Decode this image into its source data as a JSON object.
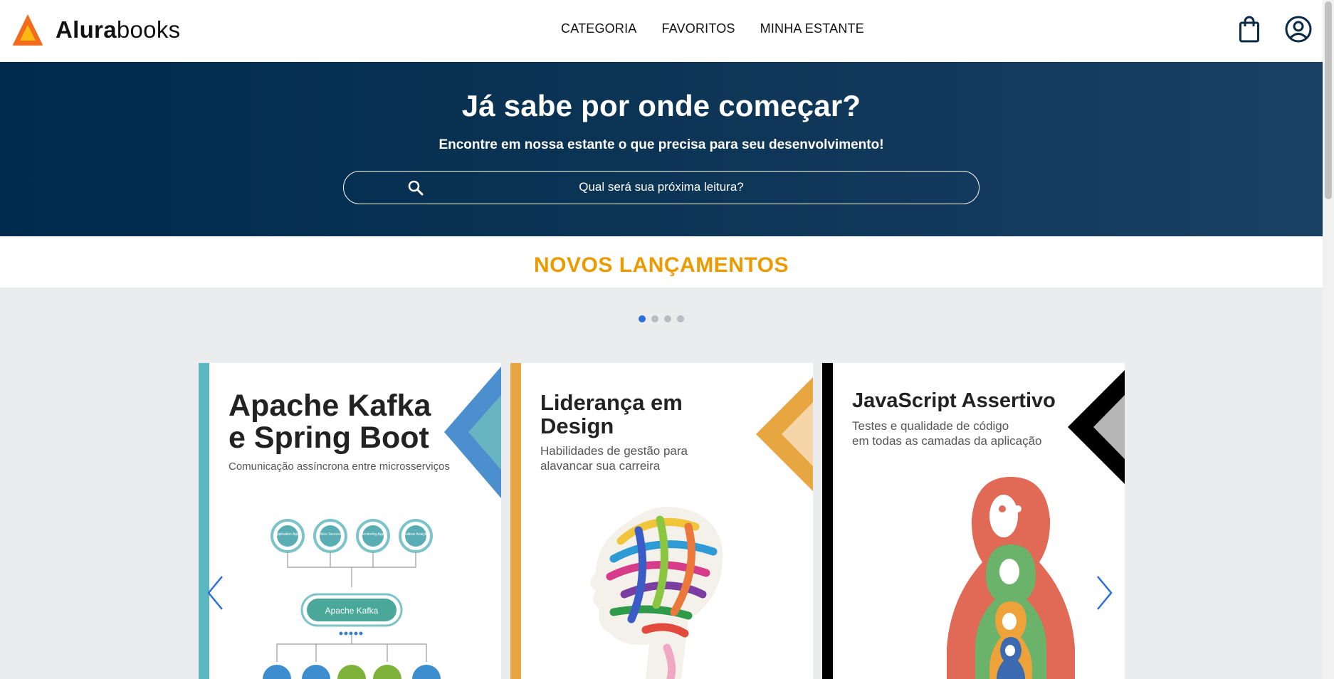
{
  "header": {
    "logo_bold": "Alura",
    "logo_light": "books",
    "nav": [
      "CATEGORIA",
      "FAVORITOS",
      "MINHA ESTANTE"
    ],
    "icons": [
      "shopping-bag-icon",
      "user-icon"
    ]
  },
  "hero": {
    "title": "Já sabe por onde começar?",
    "subtitle": "Encontre em nossa estante o que precisa para seu desenvolvimento!",
    "search_placeholder": "Qual será sua próxima leitura?"
  },
  "section": {
    "title": "NOVOS LANÇAMENTOS"
  },
  "carousel": {
    "dots": 4,
    "active_dot": 1,
    "books": [
      {
        "title_line1": "Apache Kafka",
        "title_line2": "e Spring Boot",
        "subtitle": "Comunicação assíncrona entre microsserviços",
        "diagram_label": "Apache Kafka",
        "node_labels": [
          "Application Apps",
          "Micro Services",
          "Monitoring Apps",
          "Realtime Analytics"
        ],
        "accent": "#5bb8c0"
      },
      {
        "title_line1": "Liderança em",
        "title_line2": "Design",
        "subtitle_line1": "Habilidades de gestão para",
        "subtitle_line2": "alavancar sua carreira",
        "accent": "#e8a640"
      },
      {
        "title_line1": "JavaScript Assertivo",
        "subtitle_line1": "Testes e qualidade de código",
        "subtitle_line2": "em todas as camadas da aplicação",
        "accent": "#000000"
      }
    ]
  },
  "colors": {
    "hero_bg": "#0b3354",
    "section_title": "#eb9b00",
    "active_dot": "#2a6fdb",
    "arrow": "#2a6fdb"
  }
}
